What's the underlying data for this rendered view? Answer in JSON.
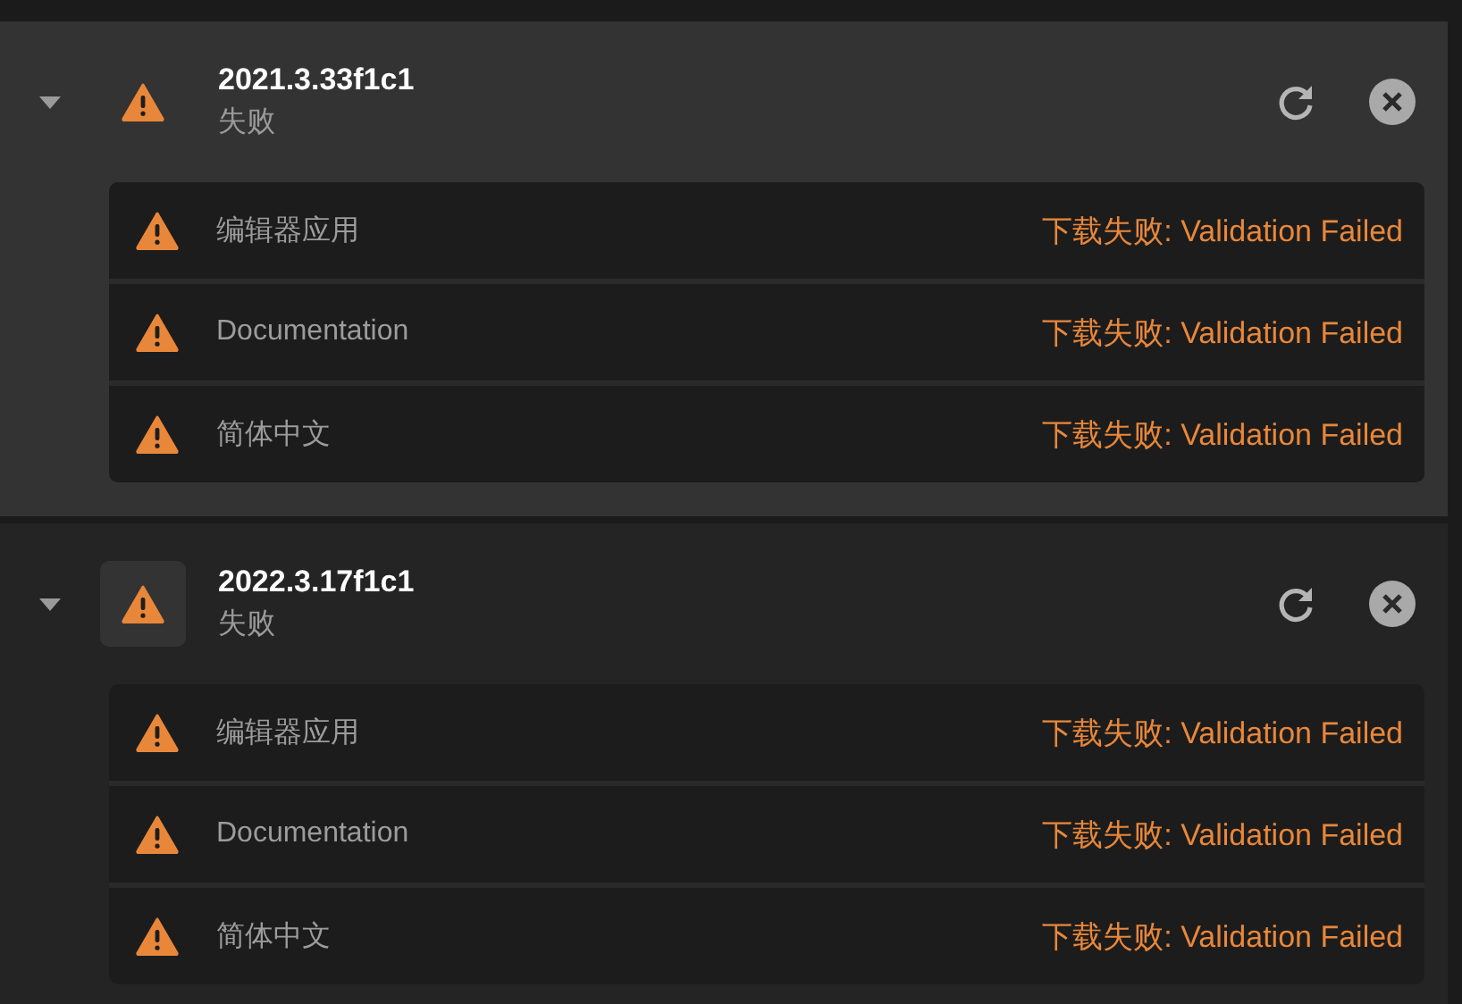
{
  "versions": [
    {
      "version": "2021.3.33f1c1",
      "status": "失败",
      "expanded": true,
      "highlighted": true,
      "icon_tile": false,
      "modules": [
        {
          "name": "编辑器应用",
          "error": "下载失败: Validation Failed"
        },
        {
          "name": "Documentation",
          "error": "下载失败: Validation Failed"
        },
        {
          "name": "简体中文",
          "error": "下载失败: Validation Failed"
        }
      ]
    },
    {
      "version": "2022.3.17f1c1",
      "status": "失败",
      "expanded": true,
      "highlighted": false,
      "icon_tile": true,
      "modules": [
        {
          "name": "编辑器应用",
          "error": "下载失败: Validation Failed"
        },
        {
          "name": "Documentation",
          "error": "下载失败: Validation Failed"
        },
        {
          "name": "简体中文",
          "error": "下载失败: Validation Failed"
        }
      ]
    }
  ]
}
